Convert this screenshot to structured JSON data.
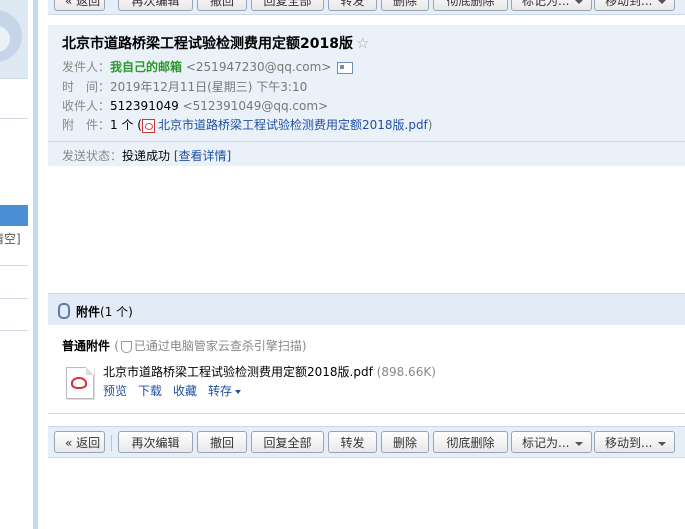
{
  "toolbar": {
    "back": "« 返回",
    "reedit": "再次编辑",
    "recall": "撤回",
    "reply_all": "回复全部",
    "forward": "转发",
    "delete": "删除",
    "perm_delete": "彻底删除",
    "mark_as": "标记为...",
    "move_to": "移动到..."
  },
  "sidebar": {
    "clear_text": "清空]"
  },
  "mail": {
    "subject": "北京市道路桥梁工程试验检测费用定额2018版",
    "star": "☆",
    "from_label": "发件人：",
    "from_name": "我自己的邮箱",
    "from_addr": "<251947230@qq.com>",
    "time_label": "时　间：",
    "time_value": "2019年12月11日(星期三) 下午3:10",
    "to_label": "收件人：",
    "to_name": "512391049",
    "to_addr": "<512391049@qq.com>",
    "att_label": "附　件：",
    "att_count": "1 个 (",
    "att_file": "北京市道路桥梁工程试验检测费用定额2018版.pdf",
    "att_close": ")",
    "status_label": "发送状态：",
    "status_value": "投递成功",
    "status_link": "[查看详情]"
  },
  "attachments": {
    "title": "附件",
    "count": "(1 个)",
    "subtitle": "普通附件",
    "scan_note_open": "(",
    "scan_note": "已通过电脑管家云查杀引擎扫描)",
    "file_name": "北京市道路桥梁工程试验检测费用定额2018版.pdf",
    "file_size": "(898.66K)",
    "preview": "预览",
    "download": "下载",
    "save": "收藏",
    "transfer": "转存"
  }
}
